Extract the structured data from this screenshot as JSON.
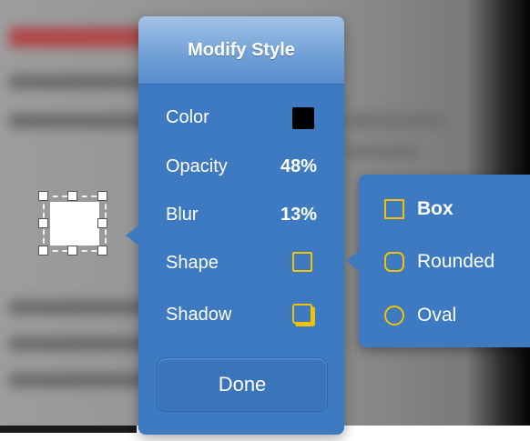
{
  "dialog": {
    "title": "Modify Style",
    "rows": {
      "color": {
        "label": "Color",
        "swatch_color": "#000000"
      },
      "opacity": {
        "label": "Opacity",
        "value": "48%"
      },
      "blur": {
        "label": "Blur",
        "value": "13%"
      },
      "shape": {
        "label": "Shape",
        "icon": "square-outline-icon"
      },
      "shadow": {
        "label": "Shadow",
        "icon": "shadow-square-icon"
      }
    },
    "done_label": "Done"
  },
  "shape_menu": {
    "options": [
      {
        "label": "Box",
        "icon": "square-icon",
        "selected": true
      },
      {
        "label": "Rounded",
        "icon": "rounded-square-icon",
        "selected": false
      },
      {
        "label": "Oval",
        "icon": "circle-icon",
        "selected": false
      }
    ]
  },
  "colors": {
    "panel_blue": "#3d7ac2",
    "header_blue": "#6f9fd6",
    "accent_yellow": "#f2c200"
  }
}
